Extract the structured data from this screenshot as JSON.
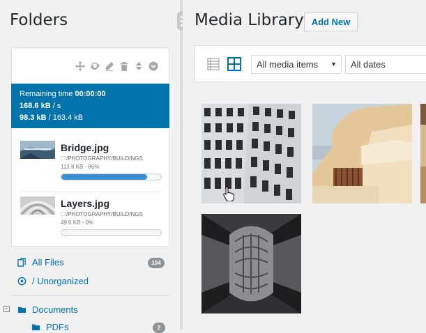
{
  "sidebar": {
    "title": "Folders",
    "toolbar_icons": [
      "move-icon",
      "refresh-icon",
      "pencil-icon",
      "trash-icon",
      "sort-icon",
      "chevron-down-circle-icon"
    ],
    "upload": {
      "remaining_label": "Remaining time",
      "remaining_value": "00:00:00",
      "speed": "168.6 kB",
      "speed_unit": " / s",
      "progress_done": "98.3 kB",
      "progress_total": " / 163.4 kB"
    },
    "files": [
      {
        "name": "Bridge.jpg",
        "path": "/PHOTOGRAPHY/BUILDINGS",
        "size": "113.8 KB - 86%",
        "progress": 0.86
      },
      {
        "name": "Layers.jpg",
        "path": "/PHOTOGRAPHY/BUILDINGS",
        "size": "49.6 KB - 0%",
        "progress": 0
      }
    ],
    "nav": {
      "all_files": "All Files",
      "all_files_count": "104",
      "unorganized": "/ Unorganized"
    },
    "tree": {
      "toggle": "−",
      "documents": "Documents",
      "pdfs": "PDFs",
      "pdfs_count": "2"
    }
  },
  "main": {
    "title": "Media Library",
    "add_new": "Add New",
    "filters": {
      "type": "All media items",
      "date": "All dates"
    }
  },
  "colors": {
    "accent": "#0073aa",
    "progress": "#3a8ed6",
    "badge": "#8d9398"
  }
}
